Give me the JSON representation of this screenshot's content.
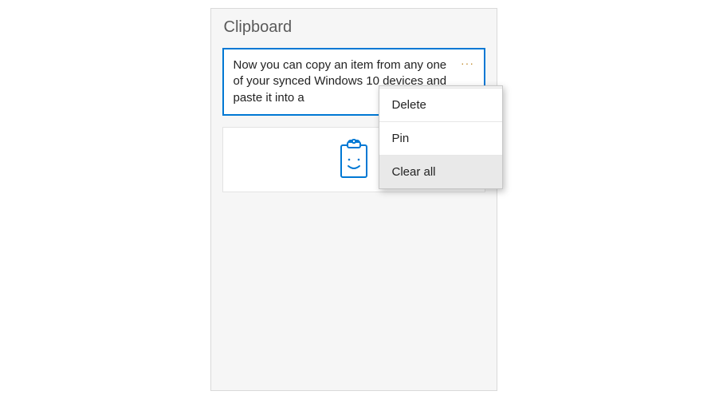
{
  "panel": {
    "title": "Clipboard"
  },
  "items": [
    {
      "type": "text",
      "selected": true,
      "text": "Now you can copy an item from any one of your synced Windows 10 devices and paste it into a"
    },
    {
      "type": "image",
      "selected": false,
      "icon": "clipboard-smile-icon"
    }
  ],
  "menu": {
    "ellipsis": "···",
    "delete": "Delete",
    "pin": "Pin",
    "clear_all": "Clear all"
  },
  "colors": {
    "accent": "#0078d4",
    "panel_bg": "#f6f6f6",
    "menu_bg": "#f2f2f2"
  }
}
